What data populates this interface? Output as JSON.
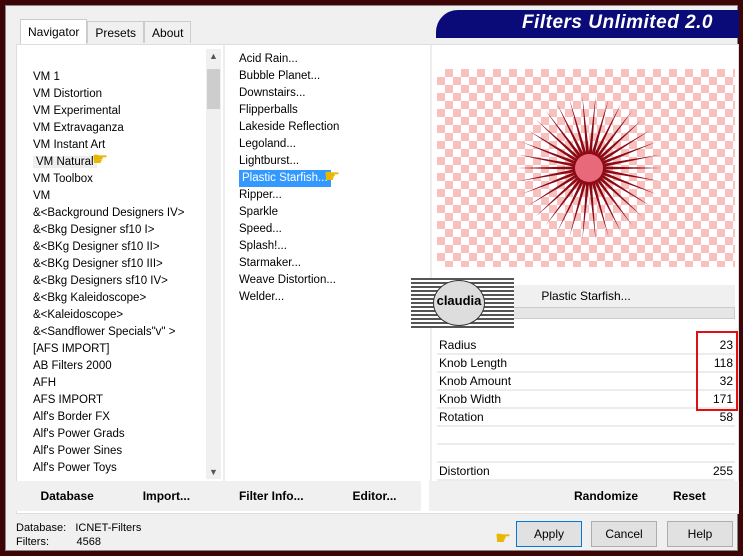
{
  "title": "Filters Unlimited 2.0",
  "tabs": [
    "Navigator",
    "Presets",
    "About"
  ],
  "categories": [
    "VM 1",
    "VM Distortion",
    "VM Experimental",
    "VM Extravaganza",
    "VM Instant Art",
    "VM Natural",
    "VM Toolbox",
    "VM",
    "&<Background Designers IV>",
    "&<Bkg Designer sf10 I>",
    "&<BKg Designer sf10 II>",
    "&<BKg Designer sf10 III>",
    "&<Bkg Designers sf10 IV>",
    "&<Bkg Kaleidoscope>",
    "&<Kaleidoscope>",
    "&<Sandflower Specials\"v\" >",
    "[AFS IMPORT]",
    "AB Filters 2000",
    "AFH",
    "AFS IMPORT",
    "Alf's Border FX",
    "Alf's Power Grads",
    "Alf's Power Sines",
    "Alf's Power Toys"
  ],
  "selected_category": "VM Natural",
  "filters": [
    "Acid Rain...",
    "Bubble Planet...",
    "Downstairs...",
    "Flipperballs",
    "Lakeside Reflection",
    "Legoland...",
    "Lightburst...",
    "Plastic Starfish...",
    "Ripper...",
    "Sparkle",
    "Speed...",
    "Splash!...",
    "Starmaker...",
    "Weave Distortion...",
    "Welder..."
  ],
  "selected_filter": "Plastic Starfish...",
  "preview_filter_name": "Plastic Starfish...",
  "logo_text": "claudia",
  "params": [
    {
      "label": "Radius",
      "value": "23"
    },
    {
      "label": "Knob Length",
      "value": "118"
    },
    {
      "label": "Knob Amount",
      "value": "32"
    },
    {
      "label": "Knob Width",
      "value": "171"
    },
    {
      "label": "Rotation",
      "value": "58"
    },
    {
      "label": "",
      "value": ""
    },
    {
      "label": "",
      "value": ""
    },
    {
      "label": "Distortion",
      "value": "255"
    }
  ],
  "buttons": {
    "database": "Database",
    "import": "Import...",
    "filter_info": "Filter Info...",
    "editor": "Editor...",
    "randomize": "Randomize",
    "reset": "Reset",
    "apply": "Apply",
    "cancel": "Cancel",
    "help": "Help"
  },
  "status": {
    "database_label": "Database:",
    "database_value": "ICNET-Filters",
    "filters_label": "Filters:",
    "filters_value": "4568"
  },
  "colors": {
    "banner": "#0a0a78",
    "selection": "#3399ff",
    "highlight": "#e01010",
    "starfish": "#8b0a14"
  }
}
